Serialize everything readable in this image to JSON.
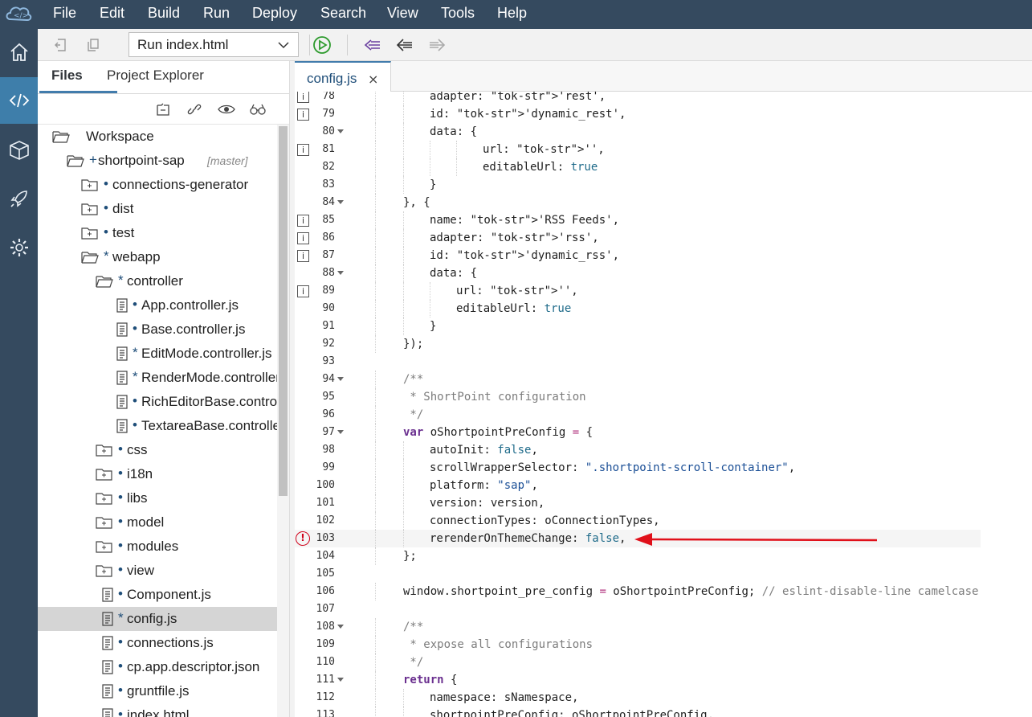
{
  "menu": [
    "File",
    "Edit",
    "Build",
    "Run",
    "Deploy",
    "Search",
    "View",
    "Tools",
    "Help"
  ],
  "toolbar": {
    "run_config": "Run index.html"
  },
  "panel": {
    "tabs": [
      "Files",
      "Project Explorer"
    ],
    "tree": [
      {
        "label": "Workspace",
        "mark": "",
        "branch": "",
        "icon": "folder-open"
      },
      {
        "label": "shortpoint-sap",
        "mark": "+",
        "branch": "[master]",
        "icon": "folder-open"
      },
      {
        "label": "connections-generator",
        "mark": "•",
        "branch": "",
        "icon": "folder-closed"
      },
      {
        "label": "dist",
        "mark": "•",
        "branch": "",
        "icon": "folder-closed"
      },
      {
        "label": "test",
        "mark": "•",
        "branch": "",
        "icon": "folder-closed"
      },
      {
        "label": "webapp",
        "mark": "*",
        "branch": "",
        "icon": "folder-open"
      },
      {
        "label": "controller",
        "mark": "*",
        "branch": "",
        "icon": "folder-open"
      },
      {
        "label": "App.controller.js",
        "mark": "•",
        "branch": "",
        "icon": "file"
      },
      {
        "label": "Base.controller.js",
        "mark": "•",
        "branch": "",
        "icon": "file"
      },
      {
        "label": "EditMode.controller.js",
        "mark": "*",
        "branch": "",
        "icon": "file"
      },
      {
        "label": "RenderMode.controller.js",
        "mark": "*",
        "branch": "",
        "icon": "file"
      },
      {
        "label": "RichEditorBase.controller.js",
        "mark": "•",
        "branch": "",
        "icon": "file"
      },
      {
        "label": "TextareaBase.controller.js",
        "mark": "•",
        "branch": "",
        "icon": "file"
      },
      {
        "label": "css",
        "mark": "•",
        "branch": "",
        "icon": "folder-closed"
      },
      {
        "label": "i18n",
        "mark": "•",
        "branch": "",
        "icon": "folder-closed"
      },
      {
        "label": "libs",
        "mark": "•",
        "branch": "",
        "icon": "folder-closed"
      },
      {
        "label": "model",
        "mark": "•",
        "branch": "",
        "icon": "folder-closed"
      },
      {
        "label": "modules",
        "mark": "•",
        "branch": "",
        "icon": "folder-closed"
      },
      {
        "label": "view",
        "mark": "•",
        "branch": "",
        "icon": "folder-closed"
      },
      {
        "label": "Component.js",
        "mark": "•",
        "branch": "",
        "icon": "file"
      },
      {
        "label": "config.js",
        "mark": "*",
        "branch": "",
        "icon": "file"
      },
      {
        "label": "connections.js",
        "mark": "•",
        "branch": "",
        "icon": "file"
      },
      {
        "label": "cp.app.descriptor.json",
        "mark": "•",
        "branch": "",
        "icon": "file"
      },
      {
        "label": "gruntfile.js",
        "mark": "•",
        "branch": "",
        "icon": "file"
      },
      {
        "label": "index.html",
        "mark": "•",
        "branch": "",
        "icon": "file"
      }
    ]
  },
  "editor": {
    "tab": "config.js",
    "tab_close": "×",
    "lines": [
      {
        "n": "78",
        "marker": "info",
        "fold": false,
        "code": "adapter: 'rest',"
      },
      {
        "n": "79",
        "marker": "info",
        "fold": false,
        "code": "id: 'dynamic_rest',"
      },
      {
        "n": "80",
        "marker": "",
        "fold": true,
        "code": "data: {"
      },
      {
        "n": "81",
        "marker": "info",
        "fold": false,
        "code": "url: '',"
      },
      {
        "n": "82",
        "marker": "",
        "fold": false,
        "code": "editableUrl: true"
      },
      {
        "n": "83",
        "marker": "",
        "fold": false,
        "code": "}"
      },
      {
        "n": "84",
        "marker": "",
        "fold": true,
        "code": "}, {"
      },
      {
        "n": "85",
        "marker": "info",
        "fold": false,
        "code": "name: 'RSS Feeds',"
      },
      {
        "n": "86",
        "marker": "info",
        "fold": false,
        "code": "adapter: 'rss',"
      },
      {
        "n": "87",
        "marker": "info",
        "fold": false,
        "code": "id: 'dynamic_rss',"
      },
      {
        "n": "88",
        "marker": "",
        "fold": true,
        "code": "data: {"
      },
      {
        "n": "89",
        "marker": "info",
        "fold": false,
        "code": "url: '',"
      },
      {
        "n": "90",
        "marker": "",
        "fold": false,
        "code": "editableUrl: true"
      },
      {
        "n": "91",
        "marker": "",
        "fold": false,
        "code": "}"
      },
      {
        "n": "92",
        "marker": "",
        "fold": false,
        "code": "});"
      },
      {
        "n": "93",
        "marker": "",
        "fold": false,
        "code": ""
      },
      {
        "n": "94",
        "marker": "",
        "fold": true,
        "code": "/**"
      },
      {
        "n": "95",
        "marker": "",
        "fold": false,
        "code": " * ShortPoint configuration"
      },
      {
        "n": "96",
        "marker": "",
        "fold": false,
        "code": " */"
      },
      {
        "n": "97",
        "marker": "",
        "fold": true,
        "code": "var oShortpointPreConfig = {"
      },
      {
        "n": "98",
        "marker": "",
        "fold": false,
        "code": "autoInit: false,"
      },
      {
        "n": "99",
        "marker": "",
        "fold": false,
        "code": "scrollWrapperSelector: \".shortpoint-scroll-container\","
      },
      {
        "n": "100",
        "marker": "",
        "fold": false,
        "code": "platform: \"sap\","
      },
      {
        "n": "101",
        "marker": "",
        "fold": false,
        "code": "version: version,"
      },
      {
        "n": "102",
        "marker": "",
        "fold": false,
        "code": "connectionTypes: oConnectionTypes,"
      },
      {
        "n": "103",
        "marker": "error",
        "fold": false,
        "code": "rerenderOnThemeChange: false,"
      },
      {
        "n": "104",
        "marker": "",
        "fold": false,
        "code": "};"
      },
      {
        "n": "105",
        "marker": "",
        "fold": false,
        "code": ""
      },
      {
        "n": "106",
        "marker": "",
        "fold": false,
        "code": "window.shortpoint_pre_config = oShortpointPreConfig; // eslint-disable-line camelcase"
      },
      {
        "n": "107",
        "marker": "",
        "fold": false,
        "code": ""
      },
      {
        "n": "108",
        "marker": "",
        "fold": true,
        "code": "/**"
      },
      {
        "n": "109",
        "marker": "",
        "fold": false,
        "code": " * expose all configurations"
      },
      {
        "n": "110",
        "marker": "",
        "fold": false,
        "code": " */"
      },
      {
        "n": "111",
        "marker": "",
        "fold": true,
        "code": "return {"
      },
      {
        "n": "112",
        "marker": "",
        "fold": false,
        "code": "namespace: sNamespace,"
      },
      {
        "n": "113",
        "marker": "",
        "fold": false,
        "code": "shortpointPreConfig: oShortpointPreConfig,"
      }
    ]
  },
  "colors": {
    "shell": "#354a5f",
    "accent": "#427cac",
    "annotation_arrow": "#e0101a"
  },
  "icons": [
    "home-icon",
    "code-icon",
    "cube-icon",
    "rocket-icon",
    "gear-icon",
    "run-icon",
    "back-icon",
    "forward-icon",
    "eye-icon",
    "link-icon",
    "binoculars-icon"
  ]
}
